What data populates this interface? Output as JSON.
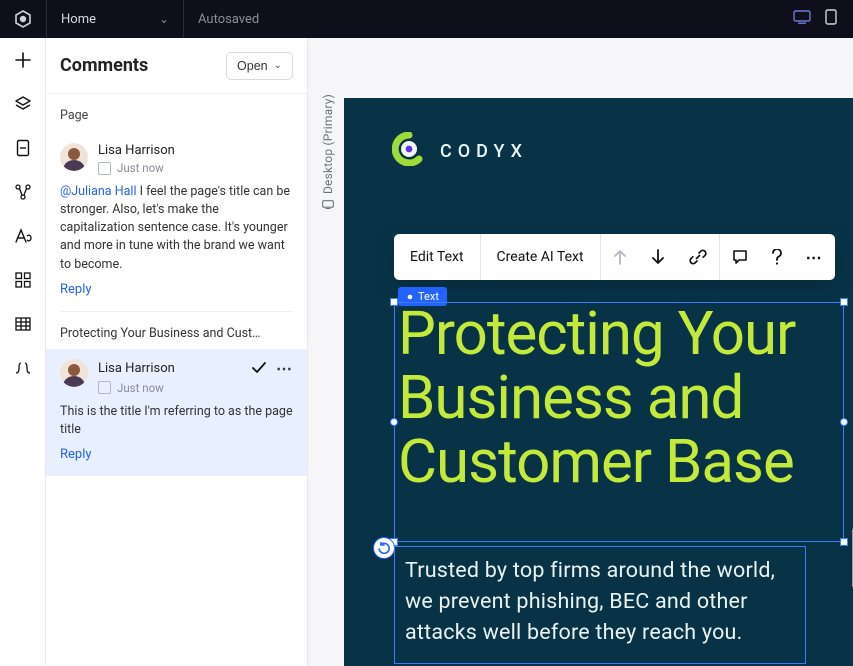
{
  "header": {
    "home_label": "Home",
    "autosaved": "Autosaved"
  },
  "devices": {
    "desktop": "desktop-icon",
    "mobile": "mobile-icon"
  },
  "panel": {
    "title": "Comments",
    "open_label": "Open",
    "section_page": "Page",
    "thread_title": "Protecting Your Business and Cust…"
  },
  "comment1": {
    "author": "Lisa Harrison",
    "time": "Just now",
    "mention": "@Juliana Hall",
    "body": " I feel the page's title can be stronger. Also, let's make the capitalization sentence case. It's younger and more in tune with the brand we want to become.",
    "reply": "Reply"
  },
  "comment2": {
    "author": "Lisa Harrison",
    "time": "Just now",
    "body": "This is the title I'm referring to as the page title",
    "reply": "Reply"
  },
  "breakpoint": "Desktop (Primary)",
  "brand": {
    "name": "CODYX"
  },
  "toolbar": {
    "edit_text": "Edit Text",
    "create_ai": "Create AI Text"
  },
  "canvas": {
    "text_badge": "Text",
    "headline": "Protecting Your Business and Customer Base",
    "subhead": "Trusted by top firms around the world, we prevent phishing, BEC and other attacks well before they reach you."
  }
}
